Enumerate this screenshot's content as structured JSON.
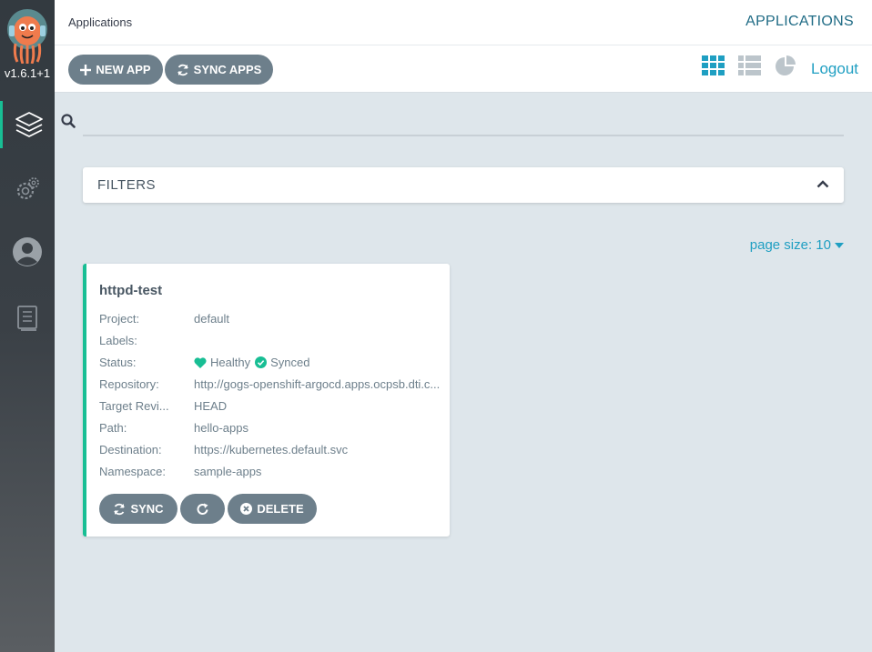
{
  "sidebar": {
    "version": "v1.6.1+1",
    "items": [
      {
        "name": "applications",
        "icon": "layers-icon"
      },
      {
        "name": "settings",
        "icon": "gear-icon"
      },
      {
        "name": "user-info",
        "icon": "user-icon"
      },
      {
        "name": "docs",
        "icon": "book-icon"
      }
    ]
  },
  "header": {
    "breadcrumb": "Applications",
    "title": "APPLICATIONS"
  },
  "toolbar": {
    "new_app_label": "NEW APP",
    "sync_apps_label": "SYNC APPS",
    "logout_label": "Logout",
    "views": [
      "tiles-view-icon",
      "list-view-icon",
      "summary-view-icon"
    ]
  },
  "search": {
    "value": "",
    "placeholder": ""
  },
  "filters": {
    "label": "FILTERS"
  },
  "pagination": {
    "page_size_label": "page size: 10"
  },
  "app_card": {
    "name": "httpd-test",
    "fields": {
      "project": {
        "label": "Project:",
        "value": "default"
      },
      "labels": {
        "label": "Labels:",
        "value": ""
      },
      "status": {
        "label": "Status:",
        "health": "Healthy",
        "sync": "Synced"
      },
      "repository": {
        "label": "Repository:",
        "value": "http://gogs-openshift-argocd.apps.ocpsb.dti.c..."
      },
      "target_revision": {
        "label": "Target Revi...",
        "value": "HEAD"
      },
      "path": {
        "label": "Path:",
        "value": "hello-apps"
      },
      "destination": {
        "label": "Destination:",
        "value": "https://kubernetes.default.svc"
      },
      "namespace": {
        "label": "Namespace:",
        "value": "sample-apps"
      }
    },
    "sync_label": "SYNC",
    "delete_label": "DELETE"
  },
  "colors": {
    "accent": "#18be94",
    "button": "#6d7f8b",
    "link": "#1f9fc2",
    "title": "#1f6b85"
  }
}
